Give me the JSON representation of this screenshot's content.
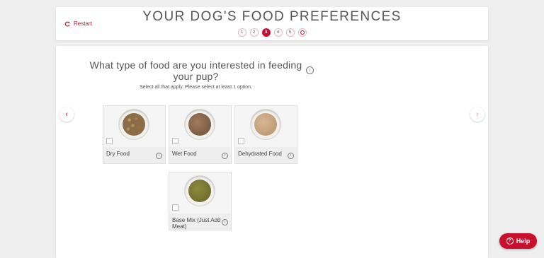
{
  "header": {
    "restart_label": "Restart",
    "title": "YOUR DOG'S FOOD PREFERENCES",
    "steps": [
      "1",
      "2",
      "3",
      "4",
      "5",
      ""
    ],
    "active_step": "3"
  },
  "question": {
    "text": "What type of food are you interested in feeding your pup?",
    "subtitle": "Select all that apply. Please select at least 1 option.",
    "info_icon": "info-icon"
  },
  "nav": {
    "prev_glyph": "‹",
    "next_glyph": "›"
  },
  "options": [
    {
      "label": "Dry Food",
      "checked": false
    },
    {
      "label": "Wet Food",
      "checked": false
    },
    {
      "label": "Dehydrated Food",
      "checked": false
    },
    {
      "label": "Base Mix (Just Add Meat)",
      "checked": false
    }
  ],
  "help": {
    "label": "Help"
  },
  "colors": {
    "accent": "#c8102e",
    "background": "#efefef"
  }
}
